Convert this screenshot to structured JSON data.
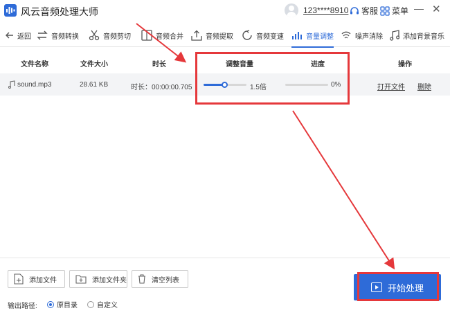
{
  "app": {
    "title": "风云音频处理大师",
    "account": "123****8910",
    "support_label": "客服",
    "menu_label": "菜单",
    "minimize_glyph": "—",
    "close_glyph": "✕"
  },
  "toolbar": {
    "items": [
      {
        "label": "返回",
        "icon": "back-arrow-icon"
      },
      {
        "label": "音频转换",
        "icon": "convert-arrows-icon"
      },
      {
        "label": "音频剪切",
        "icon": "scissors-icon"
      },
      {
        "label": "音频合并",
        "icon": "merge-icon"
      },
      {
        "label": "音频提取",
        "icon": "upload-box-icon"
      },
      {
        "label": "音频变速",
        "icon": "speed-circle-icon"
      },
      {
        "label": "音量调整",
        "icon": "volume-bars-icon",
        "active": true
      },
      {
        "label": "噪声消除",
        "icon": "noise-wave-icon"
      },
      {
        "label": "添加背景音乐",
        "icon": "music-note-icon"
      }
    ]
  },
  "table": {
    "columns": [
      "文件名称",
      "文件大小",
      "时长",
      "调整音量",
      "进度",
      "操作"
    ],
    "rows": [
      {
        "file_name": "sound.mp3",
        "file_size": "28.61 KB",
        "duration": "时长：00:00:00.705",
        "volume_value": "1.5倍",
        "volume_level": 0.5,
        "progress_text": "0%",
        "progress": 0,
        "open_file": "打开文件",
        "delete": "删除"
      }
    ]
  },
  "bottom": {
    "add_file": "添加文件",
    "add_folder": "添加文件夹",
    "clear_list": "清空列表",
    "output_path_label": "输出路径:",
    "radio_original": "原目录",
    "radio_custom": "自定义",
    "selected_radio": "原目录",
    "start_button": "开始处理"
  },
  "colors": {
    "accent": "#2e6bd8",
    "annotation_red": "#e5383b",
    "row_bg": "#f3f4f6"
  }
}
